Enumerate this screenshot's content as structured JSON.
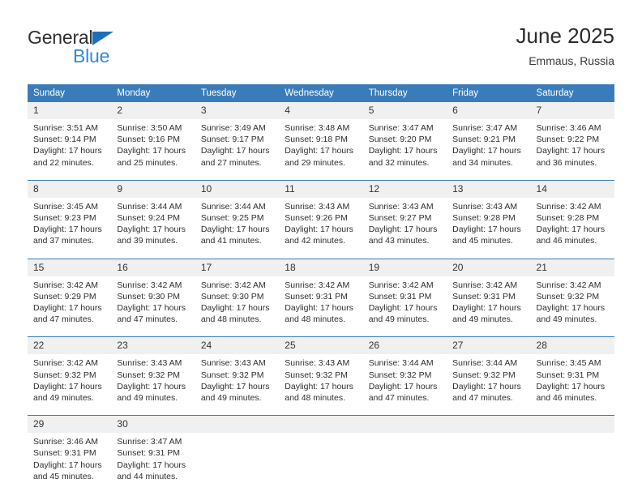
{
  "brand": {
    "name_top": "General",
    "name_bottom": "Blue",
    "triangle_color": "#1f6eb5",
    "bottom_color": "#2e8bd8"
  },
  "header": {
    "title": "June 2025",
    "subtitle": "Emmaus, Russia"
  },
  "colors": {
    "header_blue": "#3a7cba",
    "daynum_band": "#f0f0f0",
    "text": "#2e2e2e"
  },
  "calendar": {
    "weekday_headers": [
      "Sunday",
      "Monday",
      "Tuesday",
      "Wednesday",
      "Thursday",
      "Friday",
      "Saturday"
    ],
    "weeks": [
      {
        "days": [
          {
            "num": "1",
            "sunrise": "Sunrise: 3:51 AM",
            "sunset": "Sunset: 9:14 PM",
            "daylight": "Daylight: 17 hours and 22 minutes."
          },
          {
            "num": "2",
            "sunrise": "Sunrise: 3:50 AM",
            "sunset": "Sunset: 9:16 PM",
            "daylight": "Daylight: 17 hours and 25 minutes."
          },
          {
            "num": "3",
            "sunrise": "Sunrise: 3:49 AM",
            "sunset": "Sunset: 9:17 PM",
            "daylight": "Daylight: 17 hours and 27 minutes."
          },
          {
            "num": "4",
            "sunrise": "Sunrise: 3:48 AM",
            "sunset": "Sunset: 9:18 PM",
            "daylight": "Daylight: 17 hours and 29 minutes."
          },
          {
            "num": "5",
            "sunrise": "Sunrise: 3:47 AM",
            "sunset": "Sunset: 9:20 PM",
            "daylight": "Daylight: 17 hours and 32 minutes."
          },
          {
            "num": "6",
            "sunrise": "Sunrise: 3:47 AM",
            "sunset": "Sunset: 9:21 PM",
            "daylight": "Daylight: 17 hours and 34 minutes."
          },
          {
            "num": "7",
            "sunrise": "Sunrise: 3:46 AM",
            "sunset": "Sunset: 9:22 PM",
            "daylight": "Daylight: 17 hours and 36 minutes."
          }
        ]
      },
      {
        "days": [
          {
            "num": "8",
            "sunrise": "Sunrise: 3:45 AM",
            "sunset": "Sunset: 9:23 PM",
            "daylight": "Daylight: 17 hours and 37 minutes."
          },
          {
            "num": "9",
            "sunrise": "Sunrise: 3:44 AM",
            "sunset": "Sunset: 9:24 PM",
            "daylight": "Daylight: 17 hours and 39 minutes."
          },
          {
            "num": "10",
            "sunrise": "Sunrise: 3:44 AM",
            "sunset": "Sunset: 9:25 PM",
            "daylight": "Daylight: 17 hours and 41 minutes."
          },
          {
            "num": "11",
            "sunrise": "Sunrise: 3:43 AM",
            "sunset": "Sunset: 9:26 PM",
            "daylight": "Daylight: 17 hours and 42 minutes."
          },
          {
            "num": "12",
            "sunrise": "Sunrise: 3:43 AM",
            "sunset": "Sunset: 9:27 PM",
            "daylight": "Daylight: 17 hours and 43 minutes."
          },
          {
            "num": "13",
            "sunrise": "Sunrise: 3:43 AM",
            "sunset": "Sunset: 9:28 PM",
            "daylight": "Daylight: 17 hours and 45 minutes."
          },
          {
            "num": "14",
            "sunrise": "Sunrise: 3:42 AM",
            "sunset": "Sunset: 9:28 PM",
            "daylight": "Daylight: 17 hours and 46 minutes."
          }
        ]
      },
      {
        "days": [
          {
            "num": "15",
            "sunrise": "Sunrise: 3:42 AM",
            "sunset": "Sunset: 9:29 PM",
            "daylight": "Daylight: 17 hours and 47 minutes."
          },
          {
            "num": "16",
            "sunrise": "Sunrise: 3:42 AM",
            "sunset": "Sunset: 9:30 PM",
            "daylight": "Daylight: 17 hours and 47 minutes."
          },
          {
            "num": "17",
            "sunrise": "Sunrise: 3:42 AM",
            "sunset": "Sunset: 9:30 PM",
            "daylight": "Daylight: 17 hours and 48 minutes."
          },
          {
            "num": "18",
            "sunrise": "Sunrise: 3:42 AM",
            "sunset": "Sunset: 9:31 PM",
            "daylight": "Daylight: 17 hours and 48 minutes."
          },
          {
            "num": "19",
            "sunrise": "Sunrise: 3:42 AM",
            "sunset": "Sunset: 9:31 PM",
            "daylight": "Daylight: 17 hours and 49 minutes."
          },
          {
            "num": "20",
            "sunrise": "Sunrise: 3:42 AM",
            "sunset": "Sunset: 9:31 PM",
            "daylight": "Daylight: 17 hours and 49 minutes."
          },
          {
            "num": "21",
            "sunrise": "Sunrise: 3:42 AM",
            "sunset": "Sunset: 9:32 PM",
            "daylight": "Daylight: 17 hours and 49 minutes."
          }
        ]
      },
      {
        "days": [
          {
            "num": "22",
            "sunrise": "Sunrise: 3:42 AM",
            "sunset": "Sunset: 9:32 PM",
            "daylight": "Daylight: 17 hours and 49 minutes."
          },
          {
            "num": "23",
            "sunrise": "Sunrise: 3:43 AM",
            "sunset": "Sunset: 9:32 PM",
            "daylight": "Daylight: 17 hours and 49 minutes."
          },
          {
            "num": "24",
            "sunrise": "Sunrise: 3:43 AM",
            "sunset": "Sunset: 9:32 PM",
            "daylight": "Daylight: 17 hours and 49 minutes."
          },
          {
            "num": "25",
            "sunrise": "Sunrise: 3:43 AM",
            "sunset": "Sunset: 9:32 PM",
            "daylight": "Daylight: 17 hours and 48 minutes."
          },
          {
            "num": "26",
            "sunrise": "Sunrise: 3:44 AM",
            "sunset": "Sunset: 9:32 PM",
            "daylight": "Daylight: 17 hours and 47 minutes."
          },
          {
            "num": "27",
            "sunrise": "Sunrise: 3:44 AM",
            "sunset": "Sunset: 9:32 PM",
            "daylight": "Daylight: 17 hours and 47 minutes."
          },
          {
            "num": "28",
            "sunrise": "Sunrise: 3:45 AM",
            "sunset": "Sunset: 9:31 PM",
            "daylight": "Daylight: 17 hours and 46 minutes."
          }
        ]
      },
      {
        "days": [
          {
            "num": "29",
            "sunrise": "Sunrise: 3:46 AM",
            "sunset": "Sunset: 9:31 PM",
            "daylight": "Daylight: 17 hours and 45 minutes."
          },
          {
            "num": "30",
            "sunrise": "Sunrise: 3:47 AM",
            "sunset": "Sunset: 9:31 PM",
            "daylight": "Daylight: 17 hours and 44 minutes."
          },
          {
            "num": "",
            "sunrise": "",
            "sunset": "",
            "daylight": ""
          },
          {
            "num": "",
            "sunrise": "",
            "sunset": "",
            "daylight": ""
          },
          {
            "num": "",
            "sunrise": "",
            "sunset": "",
            "daylight": ""
          },
          {
            "num": "",
            "sunrise": "",
            "sunset": "",
            "daylight": ""
          },
          {
            "num": "",
            "sunrise": "",
            "sunset": "",
            "daylight": ""
          }
        ]
      }
    ]
  }
}
